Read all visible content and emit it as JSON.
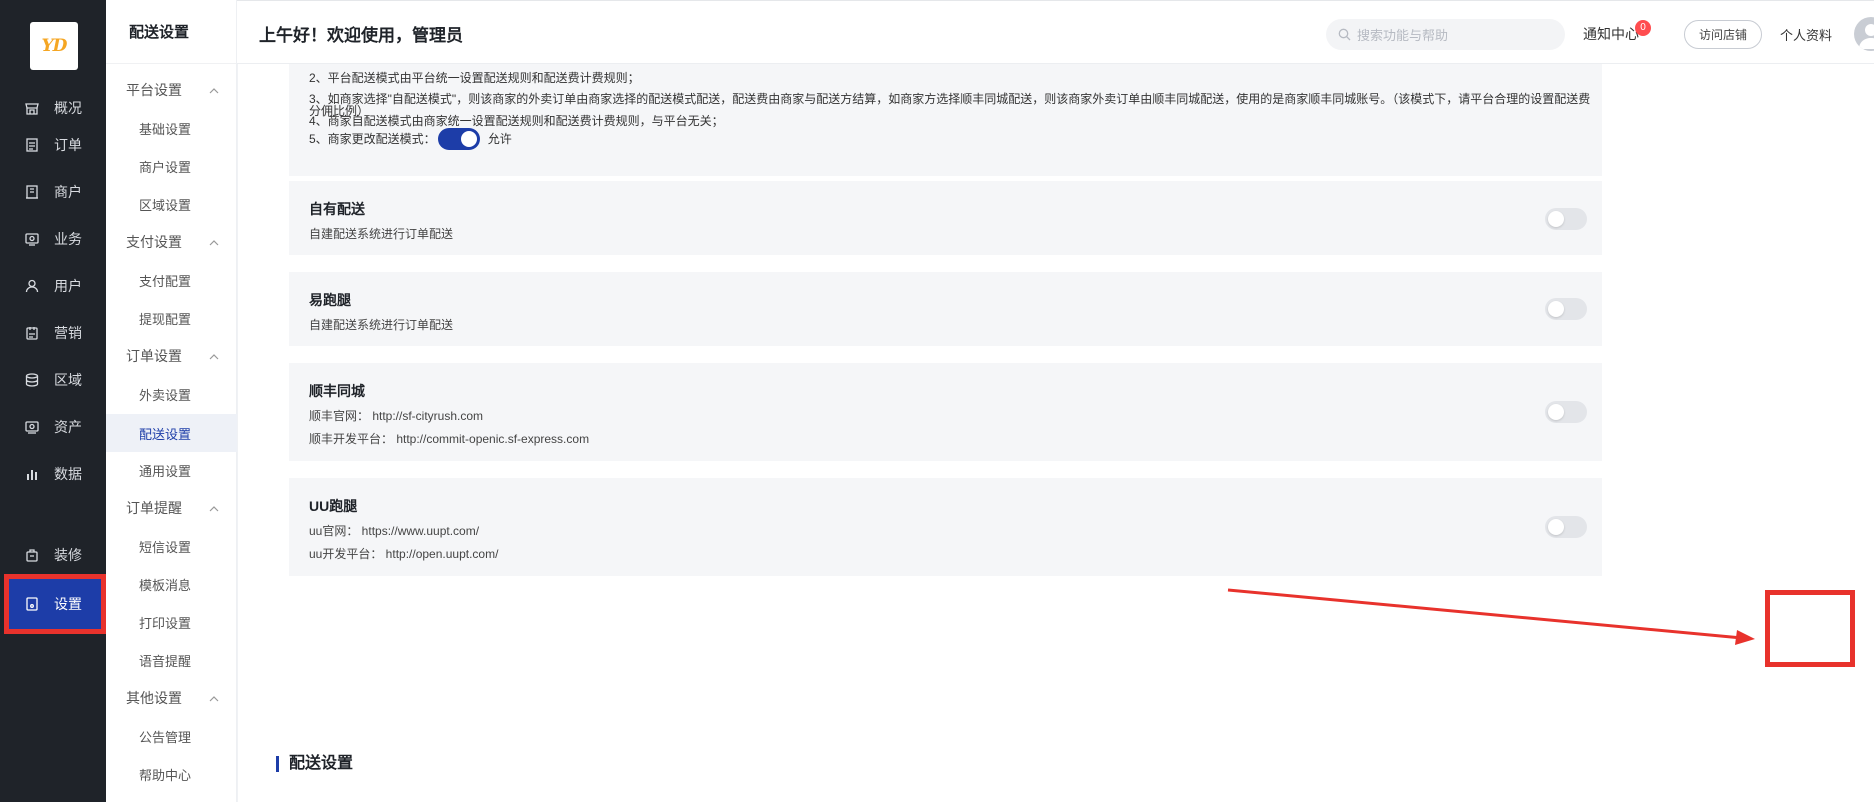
{
  "nav": {
    "logo_text": "YD",
    "items": [
      {
        "label": "概况",
        "icon": "shop-icon"
      },
      {
        "label": "订单",
        "icon": "order-icon"
      },
      {
        "label": "商户",
        "icon": "merchant-icon"
      },
      {
        "label": "业务",
        "icon": "business-icon"
      },
      {
        "label": "用户",
        "icon": "user-icon"
      },
      {
        "label": "营销",
        "icon": "marketing-icon"
      },
      {
        "label": "区域",
        "icon": "region-icon"
      },
      {
        "label": "资产",
        "icon": "asset-icon"
      },
      {
        "label": "数据",
        "icon": "chart-icon"
      },
      {
        "label": "装修",
        "icon": "decoration-icon"
      },
      {
        "label": "设置",
        "icon": "settings-icon",
        "active": true
      }
    ]
  },
  "submenu": {
    "title": "配送设置",
    "groups": [
      {
        "label": "平台设置",
        "items": [
          "基础设置",
          "商户设置",
          "区域设置"
        ]
      },
      {
        "label": "支付设置",
        "items": [
          "支付配置",
          "提现配置"
        ]
      },
      {
        "label": "订单设置",
        "items": [
          "外卖设置",
          "配送设置",
          "通用设置"
        ]
      },
      {
        "label": "订单提醒",
        "items": [
          "短信设置",
          "模板消息",
          "打印设置",
          "语音提醒"
        ]
      },
      {
        "label": "其他设置",
        "items": [
          "公告管理",
          "帮助中心"
        ]
      }
    ],
    "active_item": "配送设置"
  },
  "header": {
    "greeting": "上午好！欢迎使用，管理员",
    "search_placeholder": "搜索功能与帮助",
    "notice_label": "通知中心",
    "notice_count": "0",
    "visit_store_label": "访问店铺",
    "profile_label": "个人资料"
  },
  "notes": {
    "line2": "2、平台配送模式由平台统一设置配送规则和配送费计费规则；",
    "line3": "3、如商家选择\"自配送模式\"，则该商家的外卖订单由商家选择的配送模式配送，配送费由商家与配送方结算，如商家方选择顺丰同城配送，则该商家外卖订单由顺丰同城配送，使用的是商家顺丰同城账号。（该模式下，请平台合理的设置配送费分佣比例）",
    "line4": "4、商家自配送模式由商家统一设置配送规则和配送费计费规则，与平台无关；",
    "line5": "5、商家更改配送模式：",
    "line5_toggle_on": true,
    "line5_toggle_label": "允许"
  },
  "cards": [
    {
      "title": "自有配送",
      "lines": [
        "自建配送系统进行订单配送"
      ],
      "enabled": false
    },
    {
      "title": "易跑腿",
      "lines": [
        "自建配送系统进行订单配送"
      ],
      "enabled": false
    },
    {
      "title": "顺丰同城",
      "lines": [
        "顺丰官网： http://sf-cityrush.com",
        "顺丰开发平台： http://commit-openic.sf-express.com"
      ],
      "enabled": false
    },
    {
      "title": "UU跑腿",
      "lines": [
        "uu官网： https://www.uupt.com/",
        "uu开发平台： http://open.uupt.com/"
      ],
      "enabled": false
    }
  ],
  "section_title": "配送设置",
  "colors": {
    "brand": "#1d3da8",
    "nav_bg": "#1f2329",
    "annotation": "#e8322c",
    "badge": "#ff4d4f"
  }
}
